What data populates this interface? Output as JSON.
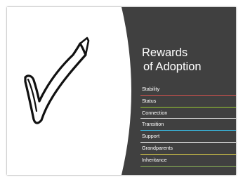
{
  "slide": {
    "title_line1": "Rewards",
    "title_line2": "of Adoption",
    "items": [
      {
        "label": "Stability",
        "underline": "#d9534f"
      },
      {
        "label": "Status",
        "underline": "#9acd32"
      },
      {
        "label": "Connection",
        "underline": "#cfcfcf"
      },
      {
        "label": "Transition",
        "underline": "#39c0ea"
      },
      {
        "label": "Support",
        "underline": "#f0f0f0"
      },
      {
        "label": "Grandparents",
        "underline": "#e0d24a"
      },
      {
        "label": "Inheritance",
        "underline": "#8fbc5a"
      }
    ],
    "colors": {
      "panel": "#404040",
      "background": "#ffffff",
      "title_text": "#ffffff",
      "checkmark": "#111111"
    },
    "checkmark_icon": "checkmark-icon"
  }
}
